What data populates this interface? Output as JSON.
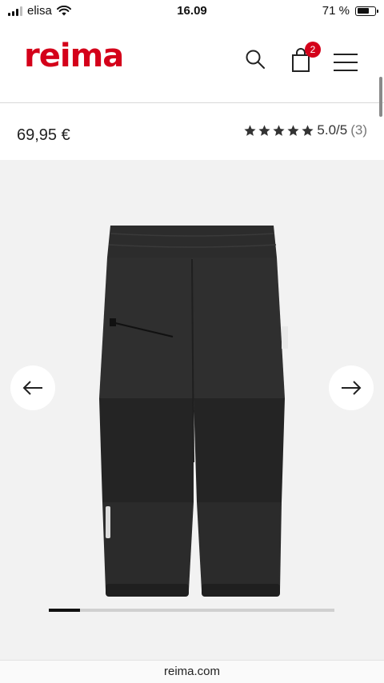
{
  "status_bar": {
    "carrier": "elisa",
    "time": "16.09",
    "battery_text": "71 %",
    "battery_level": 0.71
  },
  "header": {
    "logo_text": "reima",
    "cart_count": "2",
    "brand_color": "#d4001a",
    "icons": [
      "search-icon",
      "bag-icon",
      "menu-icon"
    ]
  },
  "product": {
    "price": "69,95 €",
    "rating_value": "5.0/5",
    "rating_count": "(3)",
    "stars": 5,
    "image": "black-pants"
  },
  "gallery": {
    "prev_icon": "arrow-left-icon",
    "next_icon": "arrow-right-icon",
    "progress": 0.11
  },
  "browser": {
    "url": "reima.com"
  }
}
